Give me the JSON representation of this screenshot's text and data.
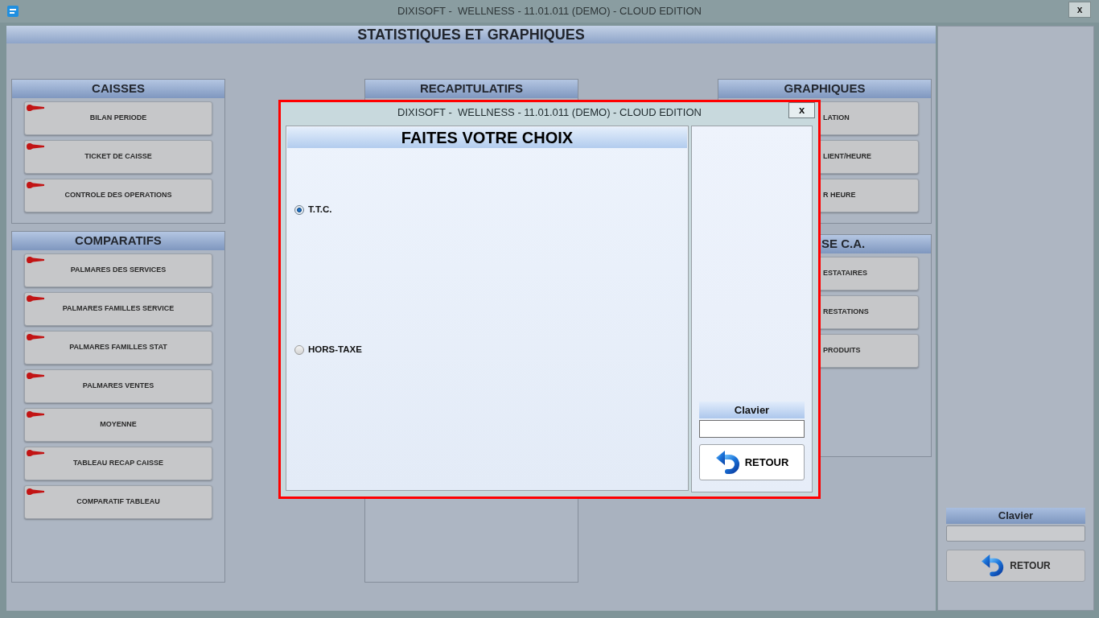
{
  "window": {
    "title": "DIXISOFT -  WELLNESS - 11.01.011 (DEMO) - CLOUD EDITION",
    "close_label": "x"
  },
  "page_title": "STATISTIQUES ET GRAPHIQUES",
  "columns": [
    {
      "groups": [
        {
          "title": "CAISSES",
          "title_covered": false,
          "buttons": [
            {
              "label": "BILAN PERIODE",
              "covered": false
            },
            {
              "label": "TICKET DE CAISSE",
              "covered": false
            },
            {
              "label": "CONTROLE DES OPERATIONS",
              "covered": false
            }
          ]
        },
        {
          "title": "COMPARATIFS",
          "title_covered": false,
          "buttons": [
            {
              "label": "PALMARES DES SERVICES",
              "covered": false
            },
            {
              "label": "PALMARES FAMILLES SERVICE",
              "covered": false
            },
            {
              "label": "PALMARES FAMILLES STAT",
              "covered": false
            },
            {
              "label": "PALMARES VENTES",
              "covered": false
            },
            {
              "label": "MOYENNE",
              "covered": false
            },
            {
              "label": "TABLEAU RECAP CAISSE",
              "covered": false
            },
            {
              "label": "COMPARATIF TABLEAU",
              "covered": false
            }
          ]
        }
      ]
    },
    {
      "groups": [
        {
          "title": "RECAPITULATIFS",
          "title_covered": false
        }
      ]
    },
    {
      "groups": [
        {
          "title": "GRAPHIQUES",
          "title_covered": false,
          "buttons": [
            {
              "label": "LATION",
              "covered": true
            },
            {
              "label": "LIENT/HEURE",
              "covered": true
            },
            {
              "label": "R HEURE",
              "covered": true
            }
          ]
        },
        {
          "title": "SE C.A.",
          "title_covered": true,
          "buttons": [
            {
              "label": "ESTATAIRES",
              "covered": true
            },
            {
              "label": "RESTATIONS",
              "covered": true
            },
            {
              "label": "PRODUITS",
              "covered": true
            }
          ]
        }
      ]
    }
  ],
  "side_panel": {
    "keyboard_label": "Clavier",
    "back_button": "RETOUR"
  },
  "dialog": {
    "title": "DIXISOFT -  WELLNESS - 11.01.011 (DEMO) - CLOUD EDITION",
    "close_label": "x",
    "heading": "FAITES VOTRE CHOIX",
    "options": [
      {
        "label": "T.T.C.",
        "selected": true
      },
      {
        "label": "HORS-TAXE",
        "selected": false
      }
    ],
    "keyboard_label": "Clavier",
    "back_button": "RETOUR"
  }
}
